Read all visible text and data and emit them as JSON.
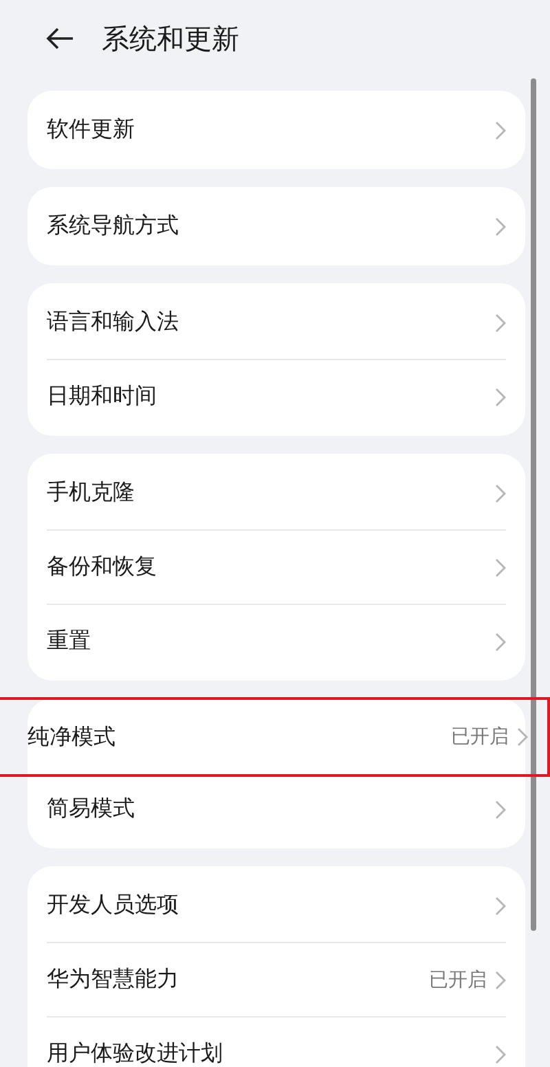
{
  "header": {
    "title": "系统和更新"
  },
  "groups": [
    {
      "items": [
        {
          "label": "软件更新",
          "highlighted": false
        }
      ]
    },
    {
      "items": [
        {
          "label": "系统导航方式",
          "highlighted": false
        }
      ]
    },
    {
      "items": [
        {
          "label": "语言和输入法",
          "highlighted": false
        },
        {
          "label": "日期和时间",
          "highlighted": false
        }
      ]
    },
    {
      "items": [
        {
          "label": "手机克隆",
          "highlighted": false
        },
        {
          "label": "备份和恢复",
          "highlighted": false
        },
        {
          "label": "重置",
          "highlighted": false
        }
      ]
    },
    {
      "items": [
        {
          "label": "纯净模式",
          "value": "已开启",
          "highlighted": true
        },
        {
          "label": "简易模式",
          "highlighted": false
        }
      ]
    },
    {
      "items": [
        {
          "label": "开发人员选项",
          "highlighted": false
        },
        {
          "label": "华为智慧能力",
          "value": "已开启",
          "highlighted": false
        },
        {
          "label": "用户体验改进计划",
          "highlighted": false
        }
      ]
    }
  ]
}
